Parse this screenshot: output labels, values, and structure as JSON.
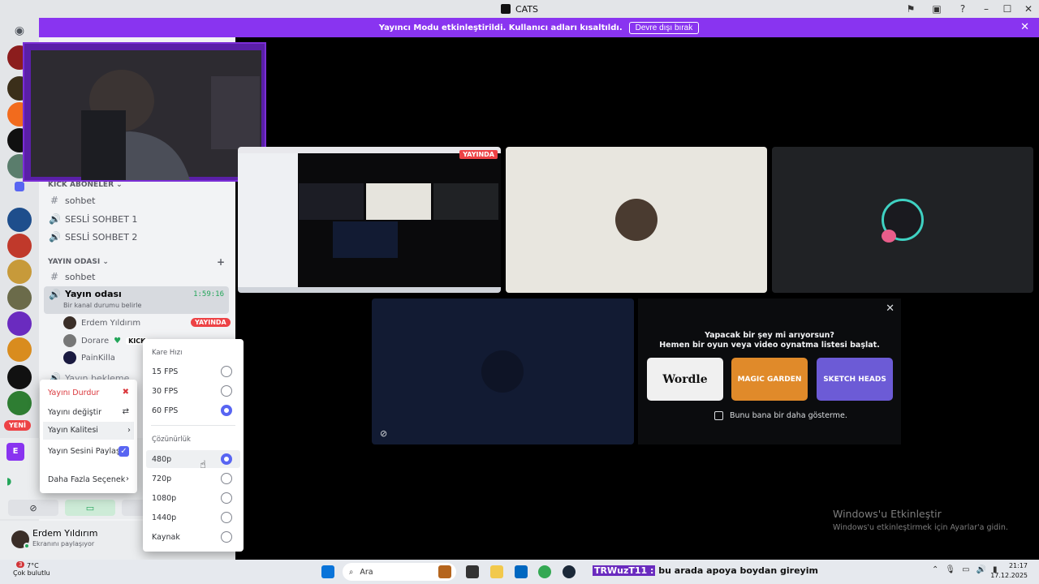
{
  "window": {
    "title": "CATS"
  },
  "banner": {
    "text": "Yayıncı Modu etkinleştirildi. Kullanıcı adları kısaltıldı.",
    "button": "Devre dışı bırak"
  },
  "sidebar": {
    "new_badge": "YENİ",
    "categories": {
      "kick": "KİCK ABONELER",
      "stream": "YAYIN ODASI"
    },
    "channels": {
      "sohbet1": "sohbet",
      "voice1": "SESLİ SOHBET 1",
      "voice2": "SESLİ SOHBET 2",
      "sohbet2": "sohbet",
      "stream_room": "Yayın odası",
      "stream_timer": "1:59:16",
      "stream_status": "Bir kanal durumu belirle",
      "waiting": "Yayın bekleme"
    },
    "members": [
      {
        "name": "Erdem Yıldırım",
        "badge": "YAYINDA"
      },
      {
        "name": "Dorare",
        "tag": "KICK"
      },
      {
        "name": "PainKilla"
      }
    ]
  },
  "context_menu": {
    "stop": "Yayını Durdur",
    "change": "Yayını değiştir",
    "quality": "Yayın Kalitesi",
    "share_audio": "Yayın Sesini Paylaş",
    "more": "Daha Fazla Seçenek"
  },
  "quality_menu": {
    "fps_header": "Kare Hızı",
    "fps_options": [
      "15 FPS",
      "30 FPS",
      "60 FPS"
    ],
    "fps_selected": "60 FPS",
    "res_header": "Çözünürlük",
    "res_options": [
      "480p",
      "720p",
      "1080p",
      "1440p",
      "Kaynak"
    ],
    "res_selected": "480p"
  },
  "user_panel": {
    "name": "Erdem Yıldırım",
    "status": "Ekranını paylaşıyor"
  },
  "stage": {
    "live_tag": "YAYINDA",
    "activity": {
      "line1": "Yapacak bir şey mi arıyorsun?",
      "line2": "Hemen bir oyun veya video oynatma listesi başlat.",
      "games": [
        "Wordle",
        "MAGIC GARDEN",
        "SKETCH HEADS"
      ],
      "dont_show": "Bunu bana bir daha gösterme."
    }
  },
  "watermark": {
    "line1": "Windows'u Etkinleştir",
    "line2": "Windows'u etkinleştirmek için Ayarlar'a gidin."
  },
  "taskbar": {
    "weather_temp": "7°C",
    "weather_desc": "Çok bulutlu",
    "weather_badge": "3",
    "search_placeholder": "Ara",
    "ticker": "bu arada apoya boydan gireyim",
    "ticker_user": "TRWuzT11 :",
    "time": "21:17",
    "date": "17.12.2025"
  },
  "colors": {
    "accent": "#5865f2",
    "banner": "#8934f0",
    "live": "#ed4245",
    "online": "#23a559"
  }
}
